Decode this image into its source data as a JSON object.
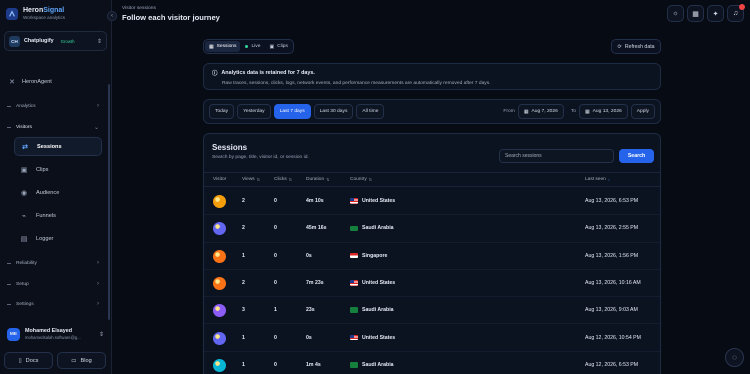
{
  "brand": {
    "name_part1": "Heron",
    "name_part2": "Signal",
    "subtitle": "Workspace analytics"
  },
  "workspace": {
    "initials": "CH",
    "name": "Chatplugify",
    "plan": "Growth"
  },
  "nav": {
    "heron_agent": "HeronAgent",
    "sections": {
      "analytics": "Analytics",
      "visitors": "Visitors",
      "reliability": "Reliability",
      "setup": "Setup",
      "settings": "Settings"
    },
    "visitor_items": [
      "Sessions",
      "Clips",
      "Audience",
      "Funnels",
      "Logger"
    ]
  },
  "user": {
    "initials": "ME",
    "name": "Mohamed Elsayed",
    "email": "mohamedsalah.software@g..."
  },
  "footer": {
    "docs": "Docs",
    "blog": "Blog"
  },
  "header": {
    "breadcrumb": "Visitor sessions",
    "title": "Follow each visitor journey"
  },
  "tabs": [
    {
      "label": "Sessions"
    },
    {
      "label": "Live"
    },
    {
      "label": "Clips"
    }
  ],
  "refresh_label": "Refresh data",
  "notice": {
    "title": "Analytics data is retained for 7 days.",
    "body": "Raw traces, sessions, clicks, logs, network events, and performance measurements are automatically removed after 7 days."
  },
  "filters": {
    "ranges": [
      "Today",
      "Yesterday",
      "Last 7 days",
      "Last 30 days",
      "All time"
    ],
    "active_range": "Last 7 days",
    "from_label": "From",
    "from_date": "Aug 7, 2026",
    "to_label": "To",
    "to_date": "Aug 13, 2026",
    "apply_label": "Apply"
  },
  "sessions": {
    "title": "Sessions",
    "subtitle": "Search by page, title, visitor id, or session id.",
    "search_placeholder": "Search sessions",
    "search_button": "Search",
    "columns": {
      "visitor": "Visitor",
      "views": "Views",
      "clicks": "Clicks",
      "duration": "Duration",
      "country": "Country",
      "last_seen": "Last seen"
    },
    "rows": [
      {
        "views": "2",
        "clicks": "0",
        "duration": "4m 10s",
        "country": "United States",
        "flag": "us",
        "last_seen": "Aug 13, 2026, 6:53 PM",
        "avatar": "#f59e0b"
      },
      {
        "views": "2",
        "clicks": "0",
        "duration": "45m 16s",
        "country": "Saudi Arabia",
        "flag": "sa",
        "last_seen": "Aug 13, 2026, 2:55 PM",
        "avatar": "#6366f1"
      },
      {
        "views": "1",
        "clicks": "0",
        "duration": "0s",
        "country": "Singapore",
        "flag": "sg",
        "last_seen": "Aug 13, 2026, 1:56 PM",
        "avatar": "#f97316"
      },
      {
        "views": "2",
        "clicks": "0",
        "duration": "7m 23s",
        "country": "United States",
        "flag": "us",
        "last_seen": "Aug 13, 2026, 10:16 AM",
        "avatar": "#f97316"
      },
      {
        "views": "3",
        "clicks": "1",
        "duration": "23s",
        "country": "Saudi Arabia",
        "flag": "sa",
        "last_seen": "Aug 13, 2026, 9:03 AM",
        "avatar": "#8b5cf6"
      },
      {
        "views": "1",
        "clicks": "0",
        "duration": "0s",
        "country": "United States",
        "flag": "us",
        "last_seen": "Aug 12, 2026, 10:54 PM",
        "avatar": "#6366f1"
      },
      {
        "views": "1",
        "clicks": "0",
        "duration": "1m 4s",
        "country": "Saudi Arabia",
        "flag": "sa",
        "last_seen": "Aug 12, 2026, 6:53 PM",
        "avatar": "#06b6d4"
      }
    ]
  },
  "colors": {
    "accent": "#2563eb",
    "live": "#34d399",
    "background": "#070b14"
  }
}
